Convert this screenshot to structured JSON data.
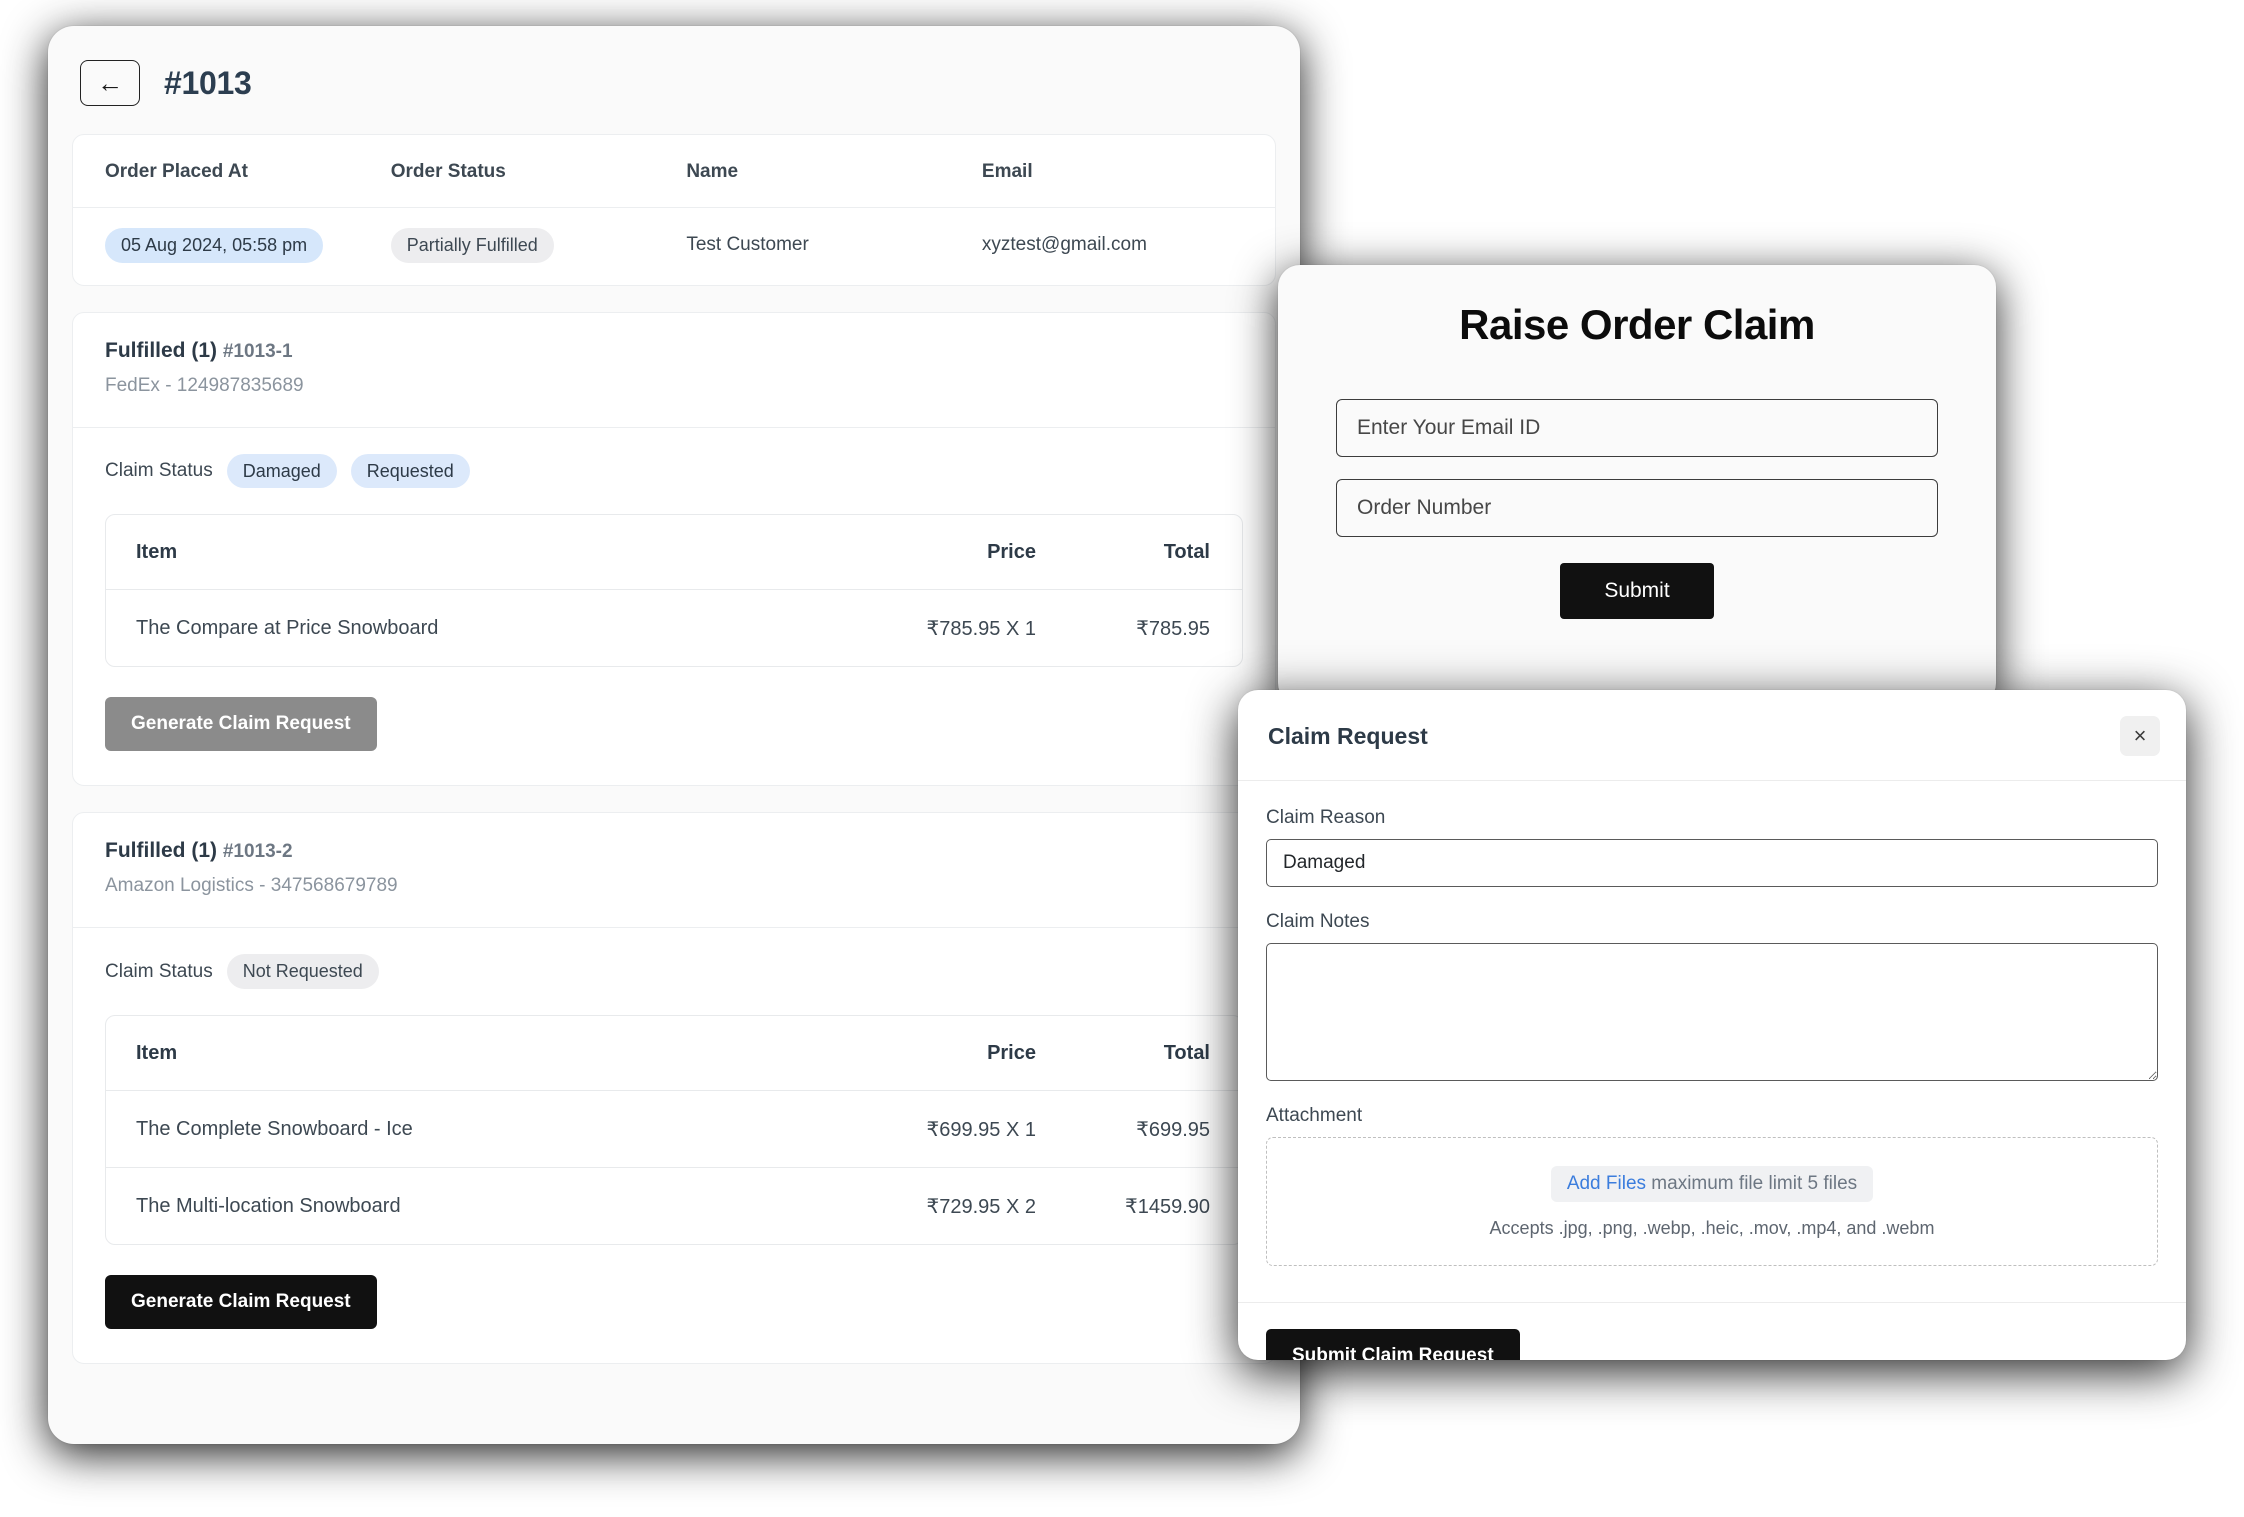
{
  "order": {
    "back_label": "←",
    "title": "#1013",
    "info_headers": [
      "Order Placed At",
      "Order Status",
      "Name",
      "Email"
    ],
    "placed_at": "05 Aug 2024, 05:58 pm",
    "status": "Partially Fulfilled",
    "customer_name": "Test Customer",
    "email": "xyztest@gmail.com"
  },
  "fulfillments": [
    {
      "title": "Fulfilled (1)",
      "number": "#1013-1",
      "carrier": "FedEx - 124987835689",
      "claim_status_label": "Claim Status",
      "claim_badges": [
        "Damaged",
        "Requested"
      ],
      "table_headers": [
        "Item",
        "Price",
        "Total"
      ],
      "items": [
        {
          "name": "The Compare at Price Snowboard",
          "price": "₹785.95 X 1",
          "total": "₹785.95"
        }
      ],
      "button_label": "Generate Claim Request",
      "button_state": "disabled"
    },
    {
      "title": "Fulfilled (1)",
      "number": "#1013-2",
      "carrier": "Amazon Logistics - 347568679789",
      "claim_status_label": "Claim Status",
      "claim_badges": [
        "Not Requested"
      ],
      "table_headers": [
        "Item",
        "Price",
        "Total"
      ],
      "items": [
        {
          "name": "The Complete Snowboard - Ice",
          "price": "₹699.95 X 1",
          "total": "₹699.95"
        },
        {
          "name": "The Multi-location Snowboard",
          "price": "₹729.95 X 2",
          "total": "₹1459.90"
        }
      ],
      "button_label": "Generate Claim Request",
      "button_state": "active"
    }
  ],
  "raise_modal": {
    "title": "Raise Order Claim",
    "email_placeholder": "Enter Your Email ID",
    "email_value": "",
    "order_placeholder": "Order Number",
    "order_value": "",
    "submit_label": "Submit"
  },
  "claim_panel": {
    "title": "Claim Request",
    "close_icon": "×",
    "reason_label": "Claim Reason",
    "reason_value": "Damaged",
    "notes_label": "Claim Notes",
    "notes_value": "",
    "attachment_label": "Attachment",
    "add_files_link": "Add Files",
    "add_files_rest": " maximum file limit 5 files",
    "accepts_text": "Accepts .jpg, .png, .webp, .heic, .mov, .mp4, and .webm",
    "submit_label": "Submit Claim Request"
  },
  "colors": {
    "accent_blue": "#3b7ddd",
    "badge_blue": "#d6e7fb",
    "badge_gray": "#ededef",
    "button_dark": "#111111",
    "button_disabled": "#8b8b8b"
  }
}
